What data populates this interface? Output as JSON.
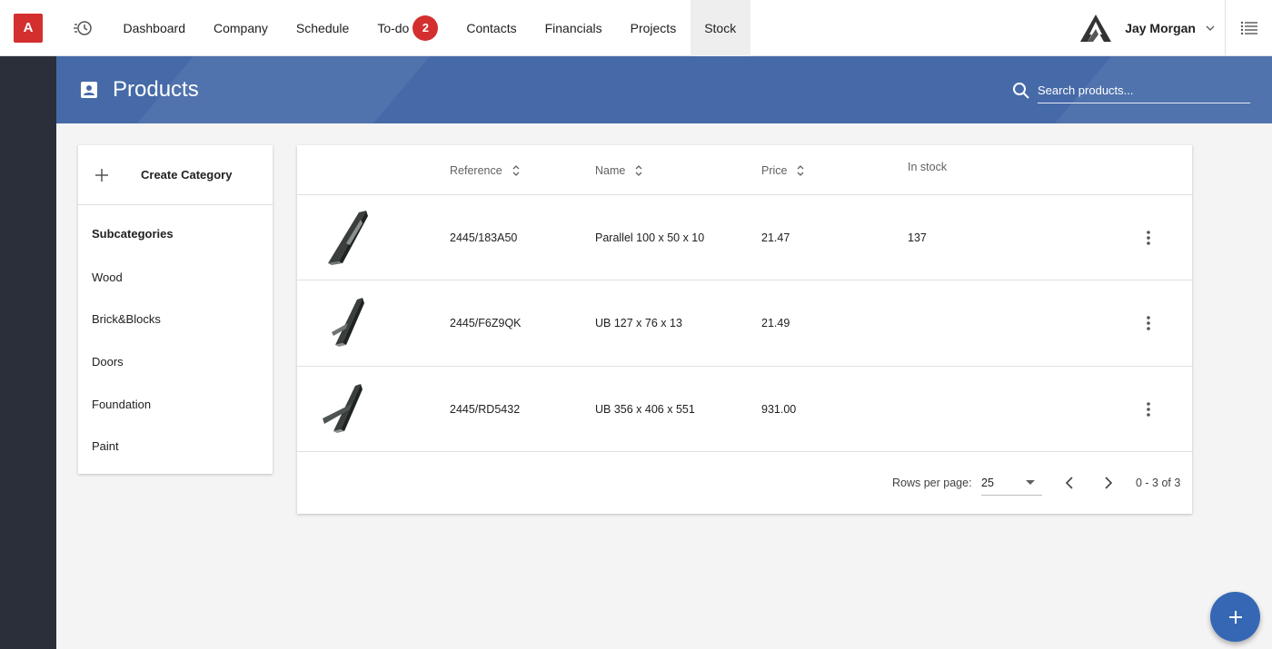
{
  "app": {
    "logo_letter": "A"
  },
  "nav": {
    "items": [
      {
        "label": "Dashboard"
      },
      {
        "label": "Company"
      },
      {
        "label": "Schedule"
      },
      {
        "label": "To-do",
        "badge": "2"
      },
      {
        "label": "Contacts"
      },
      {
        "label": "Financials"
      },
      {
        "label": "Projects"
      },
      {
        "label": "Stock",
        "active": true
      }
    ]
  },
  "user": {
    "name": "Jay Morgan"
  },
  "page": {
    "title": "Products",
    "search_placeholder": "Search products..."
  },
  "categories": {
    "create_label": "Create Category",
    "subcategories_title": "Subcategories",
    "items": [
      "Wood",
      "Brick&Blocks",
      "Doors",
      "Foundation",
      "Paint"
    ]
  },
  "table": {
    "columns": {
      "reference": "Reference",
      "name": "Name",
      "price": "Price",
      "in_stock": "In stock"
    },
    "rows": [
      {
        "reference": "2445/183A50",
        "name": "Parallel 100 x 50 x 10",
        "price": "21.47",
        "in_stock": "137"
      },
      {
        "reference": "2445/F6Z9QK",
        "name": "UB 127 x 76 x 13",
        "price": "21.49",
        "in_stock": ""
      },
      {
        "reference": "2445/RD5432",
        "name": "UB 356 x 406 x 551",
        "price": "931.00",
        "in_stock": ""
      }
    ],
    "footer": {
      "rows_per_page_label": "Rows per page:",
      "rows_per_page_value": "25",
      "range": "0 - 3 of 3"
    }
  },
  "colors": {
    "brand_red": "#d32f2f",
    "header_blue": "#466aa8",
    "fab_blue": "#3567b5",
    "rail_dark": "#2b2f3a"
  }
}
